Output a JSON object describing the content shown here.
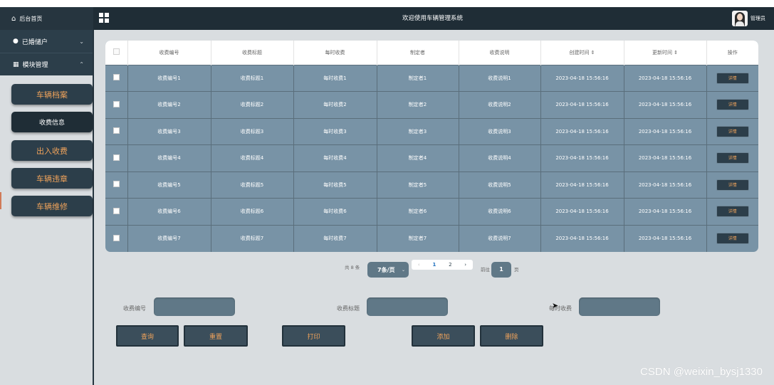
{
  "topbar": {
    "home_label": "后台首页",
    "site_title": "欢迎使用车辆管理系统",
    "user_label": "管理员"
  },
  "sidebar": {
    "section_user": "已婚储户",
    "section_modules": "模块管理",
    "items": [
      {
        "label": "车辆档案",
        "active": false
      },
      {
        "label": "收费信息",
        "active": true
      },
      {
        "label": "出入收费",
        "active": false
      },
      {
        "label": "车辆违章",
        "active": false
      },
      {
        "label": "车辆维修",
        "active": false
      }
    ]
  },
  "table": {
    "headers": [
      "收费编号",
      "收费标题",
      "每时收费",
      "制定者",
      "收费说明",
      "创建时间 ⇕",
      "更新时间 ⇕",
      "操作"
    ],
    "rows": [
      [
        "收费编号1",
        "收费标题1",
        "每时收费1",
        "制定者1",
        "收费说明1",
        "2023-04-18 15:56:16",
        "2023-04-18 15:56:16",
        "详情"
      ],
      [
        "收费编号2",
        "收费标题2",
        "每时收费2",
        "制定者2",
        "收费说明2",
        "2023-04-18 15:56:16",
        "2023-04-18 15:56:16",
        "详情"
      ],
      [
        "收费编号3",
        "收费标题3",
        "每时收费3",
        "制定者3",
        "收费说明3",
        "2023-04-18 15:56:16",
        "2023-04-18 15:56:16",
        "详情"
      ],
      [
        "收费编号4",
        "收费标题4",
        "每时收费4",
        "制定者4",
        "收费说明4",
        "2023-04-18 15:56:16",
        "2023-04-18 15:56:16",
        "详情"
      ],
      [
        "收费编号5",
        "收费标题5",
        "每时收费5",
        "制定者5",
        "收费说明5",
        "2023-04-18 15:56:16",
        "2023-04-18 15:56:16",
        "详情"
      ],
      [
        "收费编号6",
        "收费标题6",
        "每时收费6",
        "制定者6",
        "收费说明6",
        "2023-04-18 15:56:16",
        "2023-04-18 15:56:16",
        "详情"
      ],
      [
        "收费编号7",
        "收费标题7",
        "每时收费7",
        "制定者7",
        "收费说明7",
        "2023-04-18 15:56:16",
        "2023-04-18 15:56:16",
        "详情"
      ]
    ]
  },
  "pager": {
    "total": "共 8 条",
    "page_size": "7条/页",
    "prev": "‹",
    "pages": [
      "1",
      "2"
    ],
    "next": "›",
    "goto": "前往",
    "current": "1",
    "unit": "页"
  },
  "search": {
    "field1_label": "收费编号",
    "field2_label": "收费标题",
    "field3_label": "每时收费"
  },
  "actions": {
    "query": "查询",
    "reset": "重置",
    "print": "打印",
    "add": "添加",
    "delete": "删除"
  },
  "watermark": "CSDN @weixin_bysj1330",
  "colors": {
    "topbar": "#1f2d36",
    "sidebar_bg": "#d9dde0",
    "table_row": "#7893a6",
    "accent_orange": "#f0a35b",
    "button_dark": "#2c3e4a"
  }
}
